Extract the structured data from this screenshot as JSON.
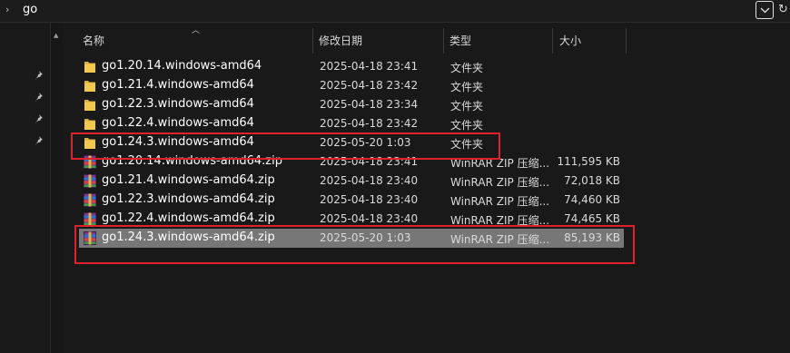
{
  "address": {
    "path": "go",
    "chevron": "›",
    "refresh": "↻"
  },
  "columns": {
    "name": "名称",
    "date": "修改日期",
    "type": "类型",
    "size": "大小"
  },
  "colors": {
    "selected_row": "#777777",
    "highlight_box": "#e0202a",
    "folder": "#f2c94c"
  },
  "rows": [
    {
      "icon": "folder-icon",
      "name": "go1.20.14.windows-amd64",
      "date": "2025-04-18 23:41",
      "type": "文件夹",
      "size": ""
    },
    {
      "icon": "folder-icon",
      "name": "go1.21.4.windows-amd64",
      "date": "2025-04-18 23:42",
      "type": "文件夹",
      "size": ""
    },
    {
      "icon": "folder-icon",
      "name": "go1.22.3.windows-amd64",
      "date": "2025-04-18 23:34",
      "type": "文件夹",
      "size": ""
    },
    {
      "icon": "folder-icon",
      "name": "go1.22.4.windows-amd64",
      "date": "2025-04-18 23:42",
      "type": "文件夹",
      "size": ""
    },
    {
      "icon": "folder-icon",
      "name": "go1.24.3.windows-amd64",
      "date": "2025-05-20 1:03",
      "type": "文件夹",
      "size": ""
    },
    {
      "icon": "winrar-archive-icon",
      "name": "go1.20.14.windows-amd64.zip",
      "date": "2025-04-18 23:41",
      "type": "WinRAR ZIP 压缩...",
      "size": "111,595 KB"
    },
    {
      "icon": "winrar-archive-icon",
      "name": "go1.21.4.windows-amd64.zip",
      "date": "2025-04-18 23:40",
      "type": "WinRAR ZIP 压缩...",
      "size": "72,018 KB"
    },
    {
      "icon": "winrar-archive-icon",
      "name": "go1.22.3.windows-amd64.zip",
      "date": "2025-04-18 23:40",
      "type": "WinRAR ZIP 压缩...",
      "size": "74,460 KB"
    },
    {
      "icon": "winrar-archive-icon",
      "name": "go1.22.4.windows-amd64.zip",
      "date": "2025-04-18 23:40",
      "type": "WinRAR ZIP 压缩...",
      "size": "74,465 KB"
    },
    {
      "icon": "winrar-archive-icon",
      "name": "go1.24.3.windows-amd64.zip",
      "date": "2025-05-20 1:03",
      "type": "WinRAR ZIP 压缩...",
      "size": "85,193 KB",
      "selected": true
    }
  ]
}
